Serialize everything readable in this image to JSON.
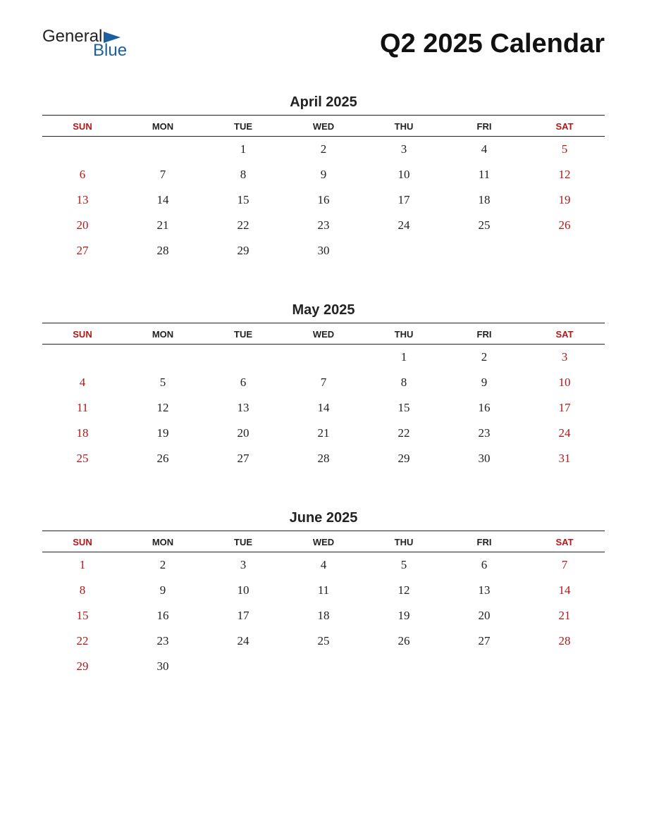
{
  "logo": {
    "word1": "General",
    "word2": "Blue"
  },
  "title": "Q2 2025 Calendar",
  "day_headers": [
    "SUN",
    "MON",
    "TUE",
    "WED",
    "THU",
    "FRI",
    "SAT"
  ],
  "months": [
    {
      "name": "April 2025",
      "weeks": [
        [
          "",
          "",
          "1",
          "2",
          "3",
          "4",
          "5"
        ],
        [
          "6",
          "7",
          "8",
          "9",
          "10",
          "11",
          "12"
        ],
        [
          "13",
          "14",
          "15",
          "16",
          "17",
          "18",
          "19"
        ],
        [
          "20",
          "21",
          "22",
          "23",
          "24",
          "25",
          "26"
        ],
        [
          "27",
          "28",
          "29",
          "30",
          "",
          "",
          ""
        ]
      ]
    },
    {
      "name": "May 2025",
      "weeks": [
        [
          "",
          "",
          "",
          "",
          "1",
          "2",
          "3"
        ],
        [
          "4",
          "5",
          "6",
          "7",
          "8",
          "9",
          "10"
        ],
        [
          "11",
          "12",
          "13",
          "14",
          "15",
          "16",
          "17"
        ],
        [
          "18",
          "19",
          "20",
          "21",
          "22",
          "23",
          "24"
        ],
        [
          "25",
          "26",
          "27",
          "28",
          "29",
          "30",
          "31"
        ]
      ]
    },
    {
      "name": "June 2025",
      "weeks": [
        [
          "1",
          "2",
          "3",
          "4",
          "5",
          "6",
          "7"
        ],
        [
          "8",
          "9",
          "10",
          "11",
          "12",
          "13",
          "14"
        ],
        [
          "15",
          "16",
          "17",
          "18",
          "19",
          "20",
          "21"
        ],
        [
          "22",
          "23",
          "24",
          "25",
          "26",
          "27",
          "28"
        ],
        [
          "29",
          "30",
          "",
          "",
          "",
          "",
          ""
        ]
      ]
    }
  ]
}
